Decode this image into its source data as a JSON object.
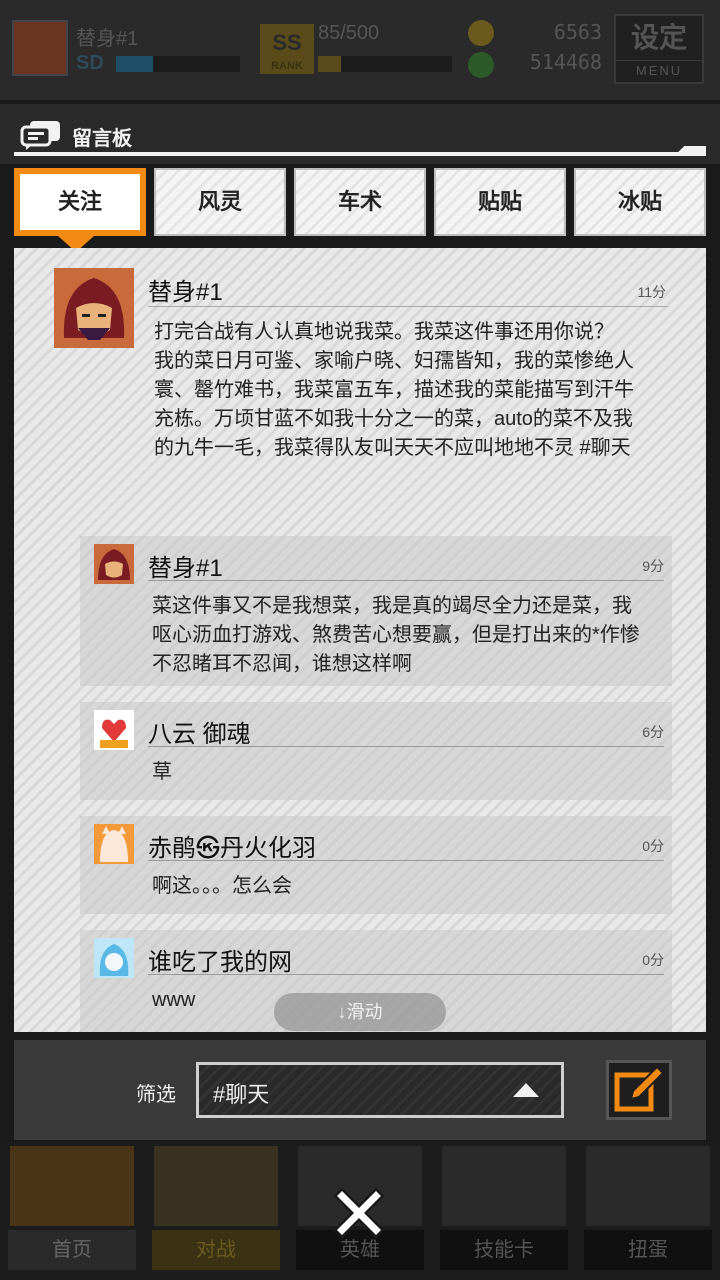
{
  "hud": {
    "player_name": "替身#1",
    "level": "SD",
    "rank_label": "RANK",
    "exp": "85/500",
    "gold": "6563",
    "gems": "514468",
    "menu_title": "设定",
    "menu_label": "MENU"
  },
  "board": {
    "title": "留言板",
    "tabs": [
      {
        "label": "关注",
        "active": true
      },
      {
        "label": "风灵"
      },
      {
        "label": "车术"
      },
      {
        "label": "贴贴"
      },
      {
        "label": "冰贴"
      }
    ],
    "main_post": {
      "name": "替身#1",
      "time": "11分",
      "body": "打完合战有人认真地说我菜。我菜这件事还用你说？\n我的菜日月可鉴、家喻户晓、妇孺皆知，我的菜惨绝人寰、罄竹难书，我菜富五车，描述我的菜能描写到汗牛充栋。万顷甘蓝不如我十分之一的菜，auto的菜不及我的九牛一毛，我菜得队友叫天天不应叫地地不灵 #聊天"
    },
    "replies": [
      {
        "name": "替身#1",
        "time": "9分",
        "body": "菜这件事又不是我想菜，我是真的竭尽全力还是菜，我呕心沥血打游戏、煞费苦心想要赢，但是打出来的*作惨不忍睹耳不忍闻，谁想这样啊"
      },
      {
        "name": "八云  御魂",
        "time": "6分",
        "body": "草"
      },
      {
        "name": "赤鹃㉿丹火化羽",
        "time": "0分",
        "body": "啊这。。。怎么会"
      },
      {
        "name": "谁吃了我的网",
        "time": "0分",
        "body": "www"
      }
    ],
    "scroll_hint": "↓滑动",
    "filter_label": "筛选",
    "filter_value": "#聊天"
  },
  "nav": [
    {
      "label": "首页",
      "glyph": "⮌"
    },
    {
      "label": "对战",
      "glyph": "⚔"
    },
    {
      "label": "英雄",
      "glyph": "勇"
    },
    {
      "label": "技能卡",
      "glyph": "备"
    },
    {
      "label": "扭蛋",
      "glyph": "购"
    }
  ],
  "colors": {
    "accent": "#f28a14",
    "panel": "#3a3a3a"
  }
}
